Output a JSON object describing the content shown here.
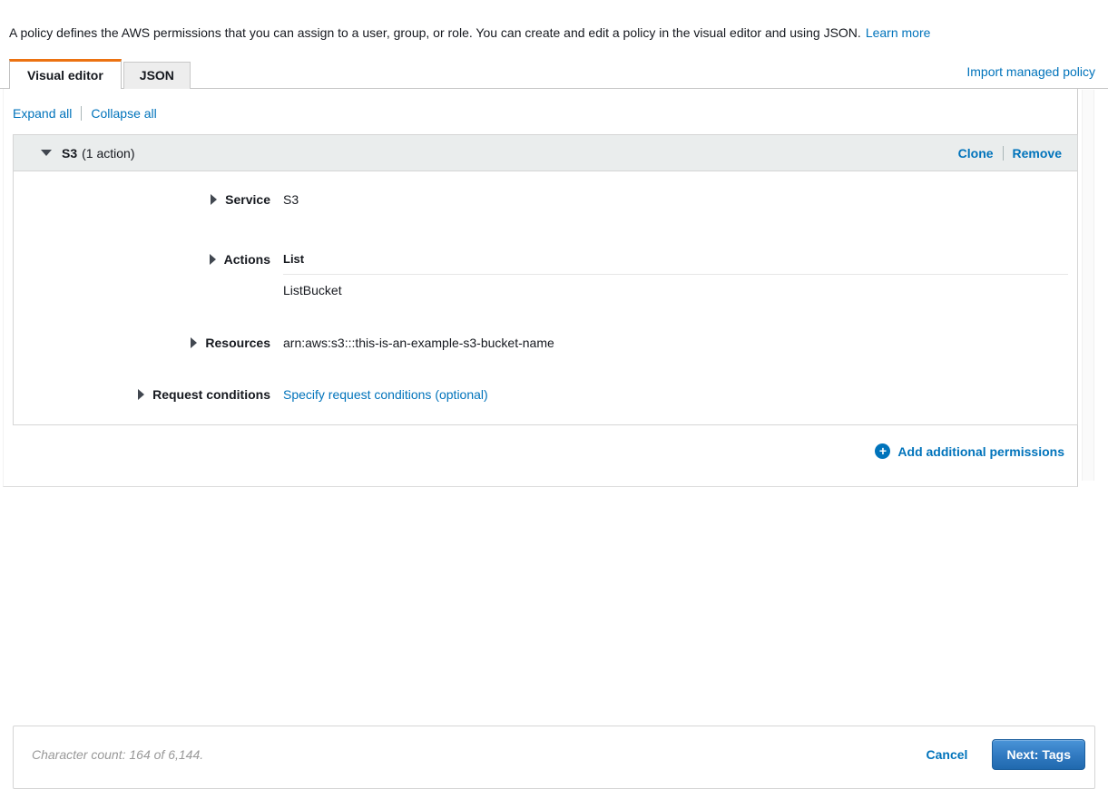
{
  "page": {
    "description": "A policy defines the AWS permissions that you can assign to a user, group, or role. You can create and edit a policy in the visual editor and using JSON.",
    "learn_more_label": "Learn more"
  },
  "tabs": {
    "visual_editor_label": "Visual editor",
    "json_label": "JSON",
    "import_link_label": "Import managed policy"
  },
  "toolbar": {
    "expand_all_label": "Expand all",
    "collapse_all_label": "Collapse all"
  },
  "permission_block": {
    "service_name": "S3",
    "action_count_label": "(1 action)",
    "clone_label": "Clone",
    "remove_label": "Remove",
    "rows": {
      "service": {
        "label": "Service",
        "value": "S3"
      },
      "actions": {
        "label": "Actions",
        "group": "List",
        "items": [
          "ListBucket"
        ]
      },
      "resources": {
        "label": "Resources",
        "value": "arn:aws:s3:::this-is-an-example-s3-bucket-name"
      },
      "request_conditions": {
        "label": "Request conditions",
        "link_label": "Specify request conditions (optional)"
      }
    }
  },
  "add_permissions_label": "Add additional permissions",
  "footer": {
    "character_count": "Character count: 164 of 6,144.",
    "cancel_label": "Cancel",
    "next_label": "Next: Tags"
  },
  "colors": {
    "accent_orange": "#ec7211",
    "link_blue": "#0073bb",
    "header_gray": "#eaeded",
    "button_blue_top": "#4a94d8",
    "button_blue_bottom": "#2069ae"
  }
}
